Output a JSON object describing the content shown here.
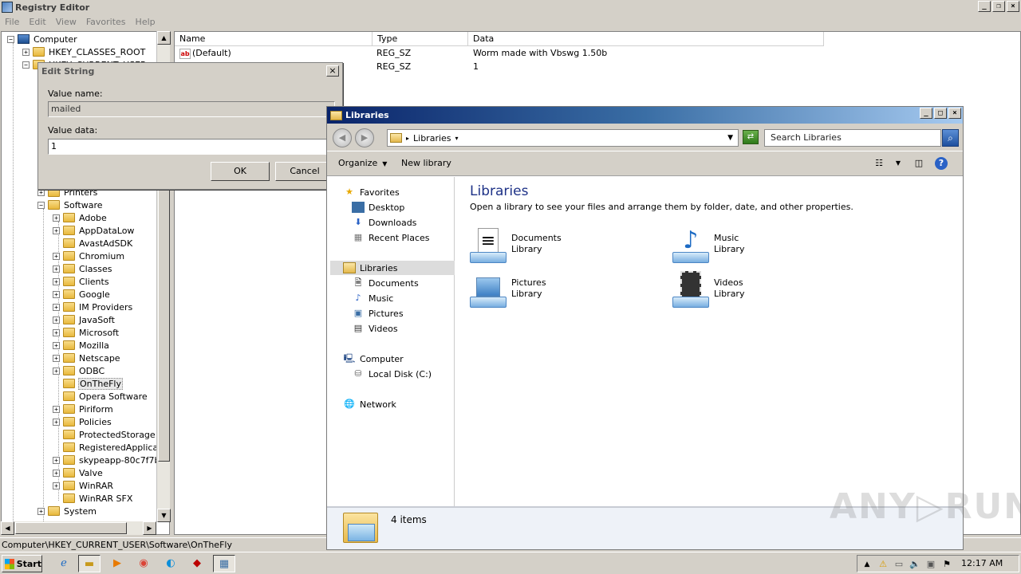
{
  "regedit": {
    "title": "Registry Editor",
    "menu": [
      "File",
      "Edit",
      "View",
      "Favorites",
      "Help"
    ],
    "tree": {
      "root": "Computer",
      "top_keys": [
        {
          "label": "HKEY_CLASSES_ROOT",
          "expander": "+"
        },
        {
          "label": "HKEY_CURRENT_USER",
          "expander": "−"
        }
      ],
      "printers": "Printers",
      "software": "Software",
      "software_children": [
        {
          "label": "Adobe",
          "expander": "+"
        },
        {
          "label": "AppDataLow",
          "expander": "+"
        },
        {
          "label": "AvastAdSDK",
          "expander": ""
        },
        {
          "label": "Chromium",
          "expander": "+"
        },
        {
          "label": "Classes",
          "expander": "+"
        },
        {
          "label": "Clients",
          "expander": "+"
        },
        {
          "label": "Google",
          "expander": "+"
        },
        {
          "label": "IM Providers",
          "expander": "+"
        },
        {
          "label": "JavaSoft",
          "expander": "+"
        },
        {
          "label": "Microsoft",
          "expander": "+"
        },
        {
          "label": "Mozilla",
          "expander": "+"
        },
        {
          "label": "Netscape",
          "expander": "+"
        },
        {
          "label": "ODBC",
          "expander": "+"
        },
        {
          "label": "OnTheFly",
          "expander": "",
          "selected": true
        },
        {
          "label": "Opera Software",
          "expander": ""
        },
        {
          "label": "Piriform",
          "expander": "+"
        },
        {
          "label": "Policies",
          "expander": "+"
        },
        {
          "label": "ProtectedStorage",
          "expander": ""
        },
        {
          "label": "RegisteredApplicatio",
          "expander": ""
        },
        {
          "label": "skypeapp-80c7f7be",
          "expander": "+"
        },
        {
          "label": "Valve",
          "expander": "+"
        },
        {
          "label": "WinRAR",
          "expander": "+"
        },
        {
          "label": "WinRAR SFX",
          "expander": ""
        }
      ],
      "system": "System"
    },
    "columns": [
      "Name",
      "Type",
      "Data"
    ],
    "values": [
      {
        "name": "(Default)",
        "type": "REG_SZ",
        "data": "Worm made with Vbswg 1.50b"
      },
      {
        "name": "",
        "type": "REG_SZ",
        "data": "1"
      }
    ],
    "status": "Computer\\HKEY_CURRENT_USER\\Software\\OnTheFly"
  },
  "edit_dialog": {
    "title": "Edit String",
    "value_name_label": "Value name:",
    "value_name": "mailed",
    "value_data_label": "Value data:",
    "value_data": "1",
    "ok_label": "OK",
    "cancel_label": "Cancel"
  },
  "libraries": {
    "title": "Libraries",
    "address": "Libraries",
    "search_placeholder": "Search Libraries",
    "toolbar": {
      "organize": "Organize",
      "new_library": "New library"
    },
    "nav": {
      "favorites": "Favorites",
      "favorites_items": [
        "Desktop",
        "Downloads",
        "Recent Places"
      ],
      "libraries": "Libraries",
      "libraries_items": [
        "Documents",
        "Music",
        "Pictures",
        "Videos"
      ],
      "computer": "Computer",
      "computer_items": [
        "Local Disk (C:)"
      ],
      "network": "Network"
    },
    "heading": "Libraries",
    "subheading": "Open a library to see your files and arrange them by folder, date, and other properties.",
    "items": [
      {
        "name": "Documents",
        "kind": "Library",
        "icon": "document-library-icon"
      },
      {
        "name": "Music",
        "kind": "Library",
        "icon": "music-library-icon"
      },
      {
        "name": "Pictures",
        "kind": "Library",
        "icon": "pictures-library-icon"
      },
      {
        "name": "Videos",
        "kind": "Library",
        "icon": "videos-library-icon"
      }
    ],
    "item_count": "4 items"
  },
  "watermark": "ANY▷RUN",
  "taskbar": {
    "start_label": "Start",
    "clock": "12:17 AM"
  }
}
